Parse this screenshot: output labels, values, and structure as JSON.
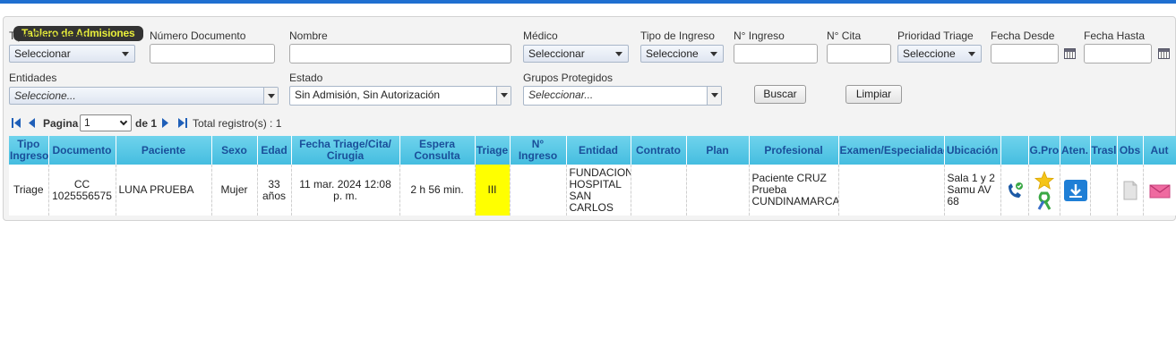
{
  "panel": {
    "title": "Tablero de Admisiones"
  },
  "filters": {
    "tipo_documento": {
      "label": "Tipo Documento",
      "value": "Seleccionar"
    },
    "numero_documento": {
      "label": "Número Documento",
      "value": ""
    },
    "nombre": {
      "label": "Nombre",
      "value": ""
    },
    "medico": {
      "label": "Médico",
      "value": "Seleccionar"
    },
    "tipo_ingreso": {
      "label": "Tipo de Ingreso",
      "value": "Seleccione"
    },
    "n_ingreso": {
      "label": "N° Ingreso",
      "value": ""
    },
    "n_cita": {
      "label": "N° Cita",
      "value": ""
    },
    "prioridad_triage": {
      "label": "Prioridad Triage",
      "value": "Seleccione"
    },
    "fecha_desde": {
      "label": "Fecha Desde",
      "value": ""
    },
    "fecha_hasta": {
      "label": "Fecha Hasta",
      "value": ""
    },
    "entidades": {
      "label": "Entidades",
      "value": "Seleccione..."
    },
    "estado": {
      "label": "Estado",
      "value": "Sin Admisión, Sin Autorización"
    },
    "grupos_protegidos": {
      "label": "Grupos Protegidos",
      "value": "Seleccionar..."
    },
    "buscar_label": "Buscar",
    "limpiar_label": "Limpiar"
  },
  "pager": {
    "pagina_label": "Pagina",
    "page_value": "1",
    "de_label": "de 1",
    "total_label": "Total registro(s) : 1"
  },
  "table": {
    "headers": [
      "Tipo Ingreso",
      "Documento",
      "Paciente",
      "Sexo",
      "Edad",
      "Fecha Triage/Cita/ Cirugia",
      "Espera Consulta",
      "Triage",
      "N° Ingreso",
      "Entidad",
      "Contrato",
      "Plan",
      "Profesional",
      "Examen/Especialidad",
      "Ubicación",
      "",
      "G.Pro",
      "Aten.",
      "Trasl",
      "Obs",
      "Aut"
    ],
    "rows": [
      {
        "tipo_ingreso": "Triage",
        "documento": "CC 1025556575",
        "paciente": "LUNA PRUEBA",
        "sexo": "Mujer",
        "edad": "33 años",
        "fecha": "11 mar. 2024 12:08 p. m.",
        "espera": "2 h 56 min.",
        "triage": "III",
        "n_ingreso": "",
        "entidad": "FUNDACION HOSPITAL SAN CARLOS",
        "contrato": "",
        "plan": "",
        "profesional": "Paciente CRUZ Prueba CUNDINAMARCA",
        "examen": "",
        "ubicacion": "Sala 1 y 2 Samu AV 68"
      }
    ]
  },
  "colors": {
    "header_bar": "#1f6fd0",
    "title_text": "#e8ee3a",
    "grid_header": "#45bde0",
    "triage_yellow": "#ffff00",
    "link": "#1a4f9a"
  },
  "icons": [
    "first-page-icon",
    "prev-page-icon",
    "next-page-icon",
    "last-page-icon",
    "calendar-icon",
    "phone-call-icon",
    "star-icon",
    "ribbon-icon",
    "download-icon",
    "document-icon",
    "mail-icon"
  ]
}
